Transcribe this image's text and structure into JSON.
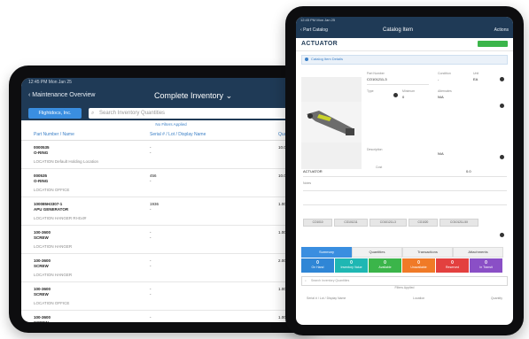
{
  "left": {
    "status": "12:45 PM   Mon Jan 25",
    "nav": {
      "back": "Maintenance Overview",
      "title": "Complete Inventory"
    },
    "company": "Flightdocs, Inc.",
    "search_placeholder": "Search Inventory Quantities",
    "filter_note": "No Filters Applied",
    "headers": {
      "part": "Part Number / Name",
      "lot": "Serial # / Lot / Display Name",
      "qty": "Quantity"
    },
    "rows": [
      {
        "pn": "0000535 O-RING",
        "loc": "LOCATION   Default Holding Location",
        "lot": "-\n-",
        "qty": "10.00 EA"
      },
      {
        "pn": "000535 O-RING",
        "loc": "LOCATION   OFFICE",
        "lot": "456\n-",
        "qty": "10.00 EA"
      },
      {
        "pn": "100085H3307-1 APU GENERATOR",
        "loc": "LOCATION   HANGER RI-Ext#",
        "lot": "1936\n-",
        "qty": "1.00 EA"
      },
      {
        "pn": "100-3600 SCREW",
        "loc": "LOCATION   HANGER",
        "lot": "-\n-",
        "qty": "1.00 EA"
      },
      {
        "pn": "100-3600 SCREW",
        "loc": "LOCATION   HANGER",
        "lot": "-\n-",
        "qty": "2.00 EA"
      },
      {
        "pn": "100-3600 SCREW",
        "loc": "LOCATION   OFFICE",
        "lot": "-\n-",
        "qty": "1.00 EA"
      },
      {
        "pn": "100-3600 SCREW",
        "loc": "",
        "lot": "-",
        "qty": "1.00 EA"
      }
    ]
  },
  "right": {
    "status": "12:45 PM   Mon Jan 25",
    "nav": {
      "back": "Part Catalog",
      "title": "Catalog Item",
      "action": "Actions"
    },
    "name": "ACTUATOR",
    "selected": "Catalog Item Details",
    "fields": {
      "part_no_lbl": "Part Number",
      "part_no": "CO101211-3",
      "cond_lbl": "Condition",
      "cond": "-",
      "unit_lbl": "Unit",
      "unit": "EA",
      "type_lbl": "Type",
      "type": "N/A",
      "min_lbl": "Minimum",
      "min": "0",
      "alt_lbl": "Alternates",
      "alt": "N/A",
      "desc_lbl": "Description",
      "desc": "ACTUATOR",
      "cost_lbl": "Cost",
      "cost": "0.0",
      "notes_lbl": "Notes"
    },
    "chips": [
      "CO1010",
      "CO101211",
      "CO101211-3",
      "CO1020",
      "CO101211-5X"
    ],
    "tabs": [
      "Summary",
      "Quantities",
      "Transactions",
      "Attachments"
    ],
    "tiles": [
      {
        "n": "0",
        "l": "On Hand",
        "color": "#2f86d6"
      },
      {
        "n": "0",
        "l": "Inventory Value",
        "color": "#1fb7b3"
      },
      {
        "n": "0",
        "l": "Available",
        "color": "#3bb54a"
      },
      {
        "n": "0",
        "l": "Unavailable",
        "color": "#f07a27"
      },
      {
        "n": "0",
        "l": "Reserved",
        "color": "#e3403f"
      },
      {
        "n": "0",
        "l": "In Transit",
        "color": "#8a4fc6"
      }
    ],
    "search2": "Search Inventory Quantities",
    "footer": "Filters Applied",
    "bottom": {
      "left": "Serial # / Lot / Display Name",
      "mid": "Location",
      "right": "Quantity"
    }
  }
}
